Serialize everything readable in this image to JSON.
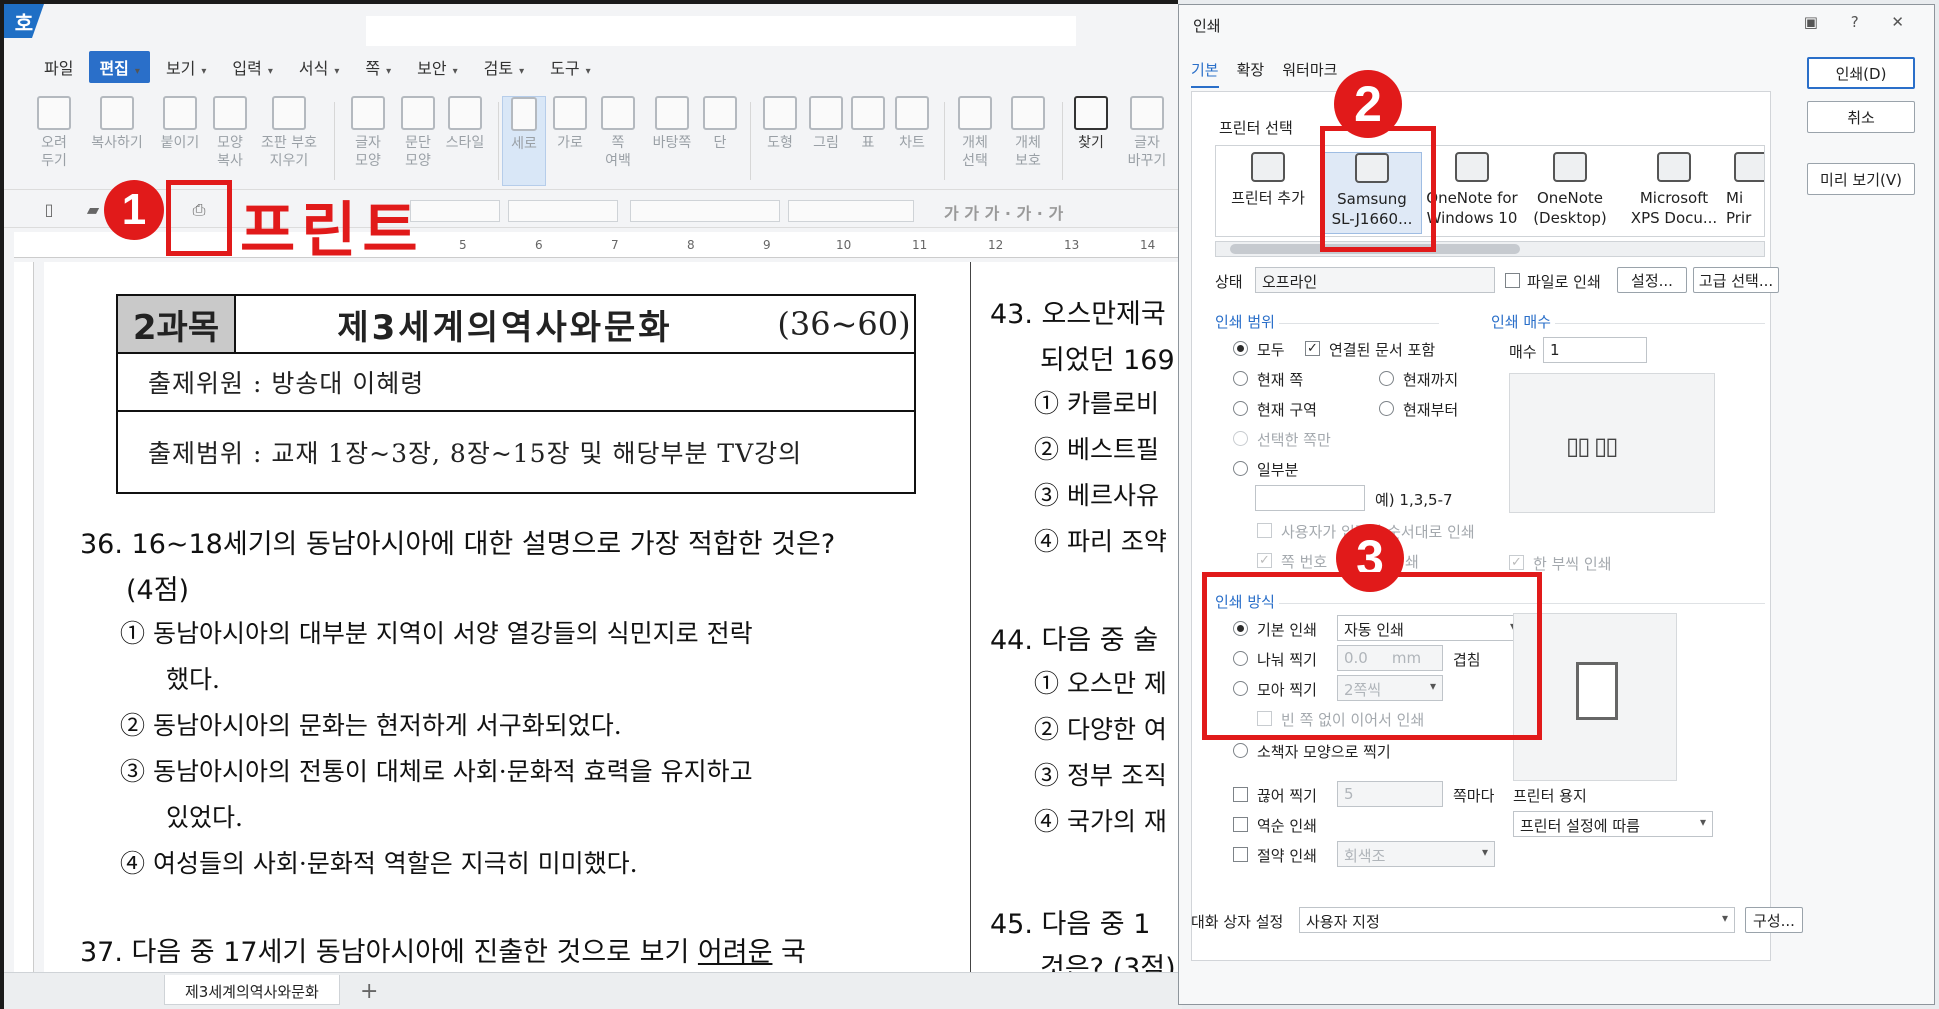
{
  "app": {
    "logo": "호",
    "menu": [
      {
        "label": "파일",
        "caret": false
      },
      {
        "label": "편집",
        "caret": true,
        "active": true
      },
      {
        "label": "보기",
        "caret": true
      },
      {
        "label": "입력",
        "caret": true
      },
      {
        "label": "서식",
        "caret": true
      },
      {
        "label": "쪽",
        "caret": true
      },
      {
        "label": "보안",
        "caret": true
      },
      {
        "label": "검토",
        "caret": true
      },
      {
        "label": "도구",
        "caret": true
      }
    ],
    "ribbon": [
      "오려\n두기",
      "복사하기",
      "붙이기",
      "모양\n복사",
      "조판 부호\n지우기",
      "글자\n모양",
      "문단\n모양",
      "스타일",
      "세로",
      "가로",
      "쪽\n여백",
      "바탕쪽",
      "단",
      "도형",
      "그림",
      "표",
      "차트",
      "개체\n선택",
      "개체\n보호",
      "찾기",
      "글자\n바꾸기"
    ],
    "ruler": [
      "5",
      "6",
      "7",
      "8",
      "9",
      "10",
      "11",
      "12",
      "13",
      "14"
    ],
    "status_tab": "제3세계의역사와문화"
  },
  "annotations": {
    "step1": "1",
    "step2": "2",
    "step3": "3",
    "print_label": "프린트"
  },
  "document": {
    "subject": "2과목",
    "title": "제3세계의역사와문화",
    "range": "(36~60)",
    "author": "출제위원 : 방송대 이혜령",
    "scope": "출제범위 : 교재 1장~3장, 8장~15장 및 해당부분 TV강의",
    "q36": "36. 16~18세기의 동남아시아에 대한 설명으로 가장 적합한 것은?",
    "q36_points": "(4점)",
    "q36_opt1a": "① 동남아시아의 대부분 지역이 서양 열강들의 식민지로 전락",
    "q36_opt1b": "했다.",
    "q36_opt2": "② 동남아시아의 문화는 현저하게 서구화되었다.",
    "q36_opt3a": "③ 동남아시아의 전통이 대체로 사회·문화적 효력을 유지하고",
    "q36_opt3b": "있었다.",
    "q36_opt4": "④ 여성들의 사회·문화적 역할은 지극히 미미했다.",
    "q37_a": "37. 다음 중 17세기 동남아시아에 진출한 것으로 보기 ",
    "q37_u": "어려운",
    "q37_b": " 국",
    "q43": "43. 오스만제국",
    "q43_l2": "되었던 169",
    "q43_o1": "① 카를로비",
    "q43_o2": "② 베스트필",
    "q43_o3": "③ 베르사유",
    "q43_o4": "④ 파리 조약",
    "q44": "44. 다음 중 술",
    "q44_o1": "① 오스만 제",
    "q44_o2": "② 다양한 여",
    "q44_o3": "③ 정부 조직",
    "q44_o4": "④ 국가의 재",
    "q45": "45. 다음 중 1",
    "q45_l2": "것은? (3점)"
  },
  "dialog": {
    "title": "인쇄",
    "title_icons": "▣ ? ✕",
    "tabs": [
      "기본",
      "확장",
      "워터마크"
    ],
    "buttons": {
      "print": "인쇄(D)",
      "cancel": "취소",
      "preview": "미리 보기(V)",
      "config": "구성..."
    },
    "printer_group": "프린터 선택",
    "printers": [
      {
        "name": "프린터 추가",
        "sub": ""
      },
      {
        "name": "Samsung",
        "sub": "SL-J1660..."
      },
      {
        "name": "OneNote for",
        "sub": "Windows 10"
      },
      {
        "name": "OneNote",
        "sub": "(Desktop)"
      },
      {
        "name": "Microsoft",
        "sub": "XPS Docu..."
      },
      {
        "name": "Mi",
        "sub": "Prir"
      }
    ],
    "status_label": "상태",
    "status_value": "오프라인",
    "print_to_file": "파일로 인쇄",
    "settings_btn": "설정...",
    "advanced_btn": "고급 선택...",
    "range_group": "인쇄 범위",
    "range_all": "모두",
    "range_linked": "연결된 문서 포함",
    "range_current_page": "현재 쪽",
    "range_until_current": "현재까지",
    "range_current_section": "현재 구역",
    "range_from_current": "현재부터",
    "range_selected": "선택한 쪽만",
    "range_partial": "일부분",
    "range_example": "예) 1,3,5-7",
    "range_user_order": "사용자가 입력한 순서대로 인쇄",
    "range_page_num": "쪽 번호",
    "range_page_num_tail": "쇄",
    "copies_group": "인쇄 매수",
    "copies_label": "매수",
    "copies_value": "1",
    "collate": "한 부씩 인쇄",
    "method_group": "인쇄 방식",
    "method_basic": "기본 인쇄",
    "method_basic_value": "자동 인쇄",
    "method_split": "나눠 찍기",
    "method_split_value": "0.0",
    "method_split_unit": "mm",
    "method_overlap": "겹침",
    "method_gather": "모아 찍기",
    "method_gather_value": "2쪽씩",
    "method_no_blank": "빈 쪽 없이 이어서 인쇄",
    "booklet": "소책자 모양으로 찍기",
    "cut": "끊어 찍기",
    "cut_value": "5",
    "cut_unit": "쪽마다",
    "reverse": "역순 인쇄",
    "saving": "절약 인쇄",
    "saving_value": "회색조",
    "paper_label": "프린터 용지",
    "paper_value": "프린터 설정에 따름",
    "dialog_setting_label": "대화 상자 설정",
    "dialog_setting_value": "사용자 지정"
  },
  "colors": {
    "accent": "#2a6fc9",
    "annotation_red": "#e11a1a"
  }
}
